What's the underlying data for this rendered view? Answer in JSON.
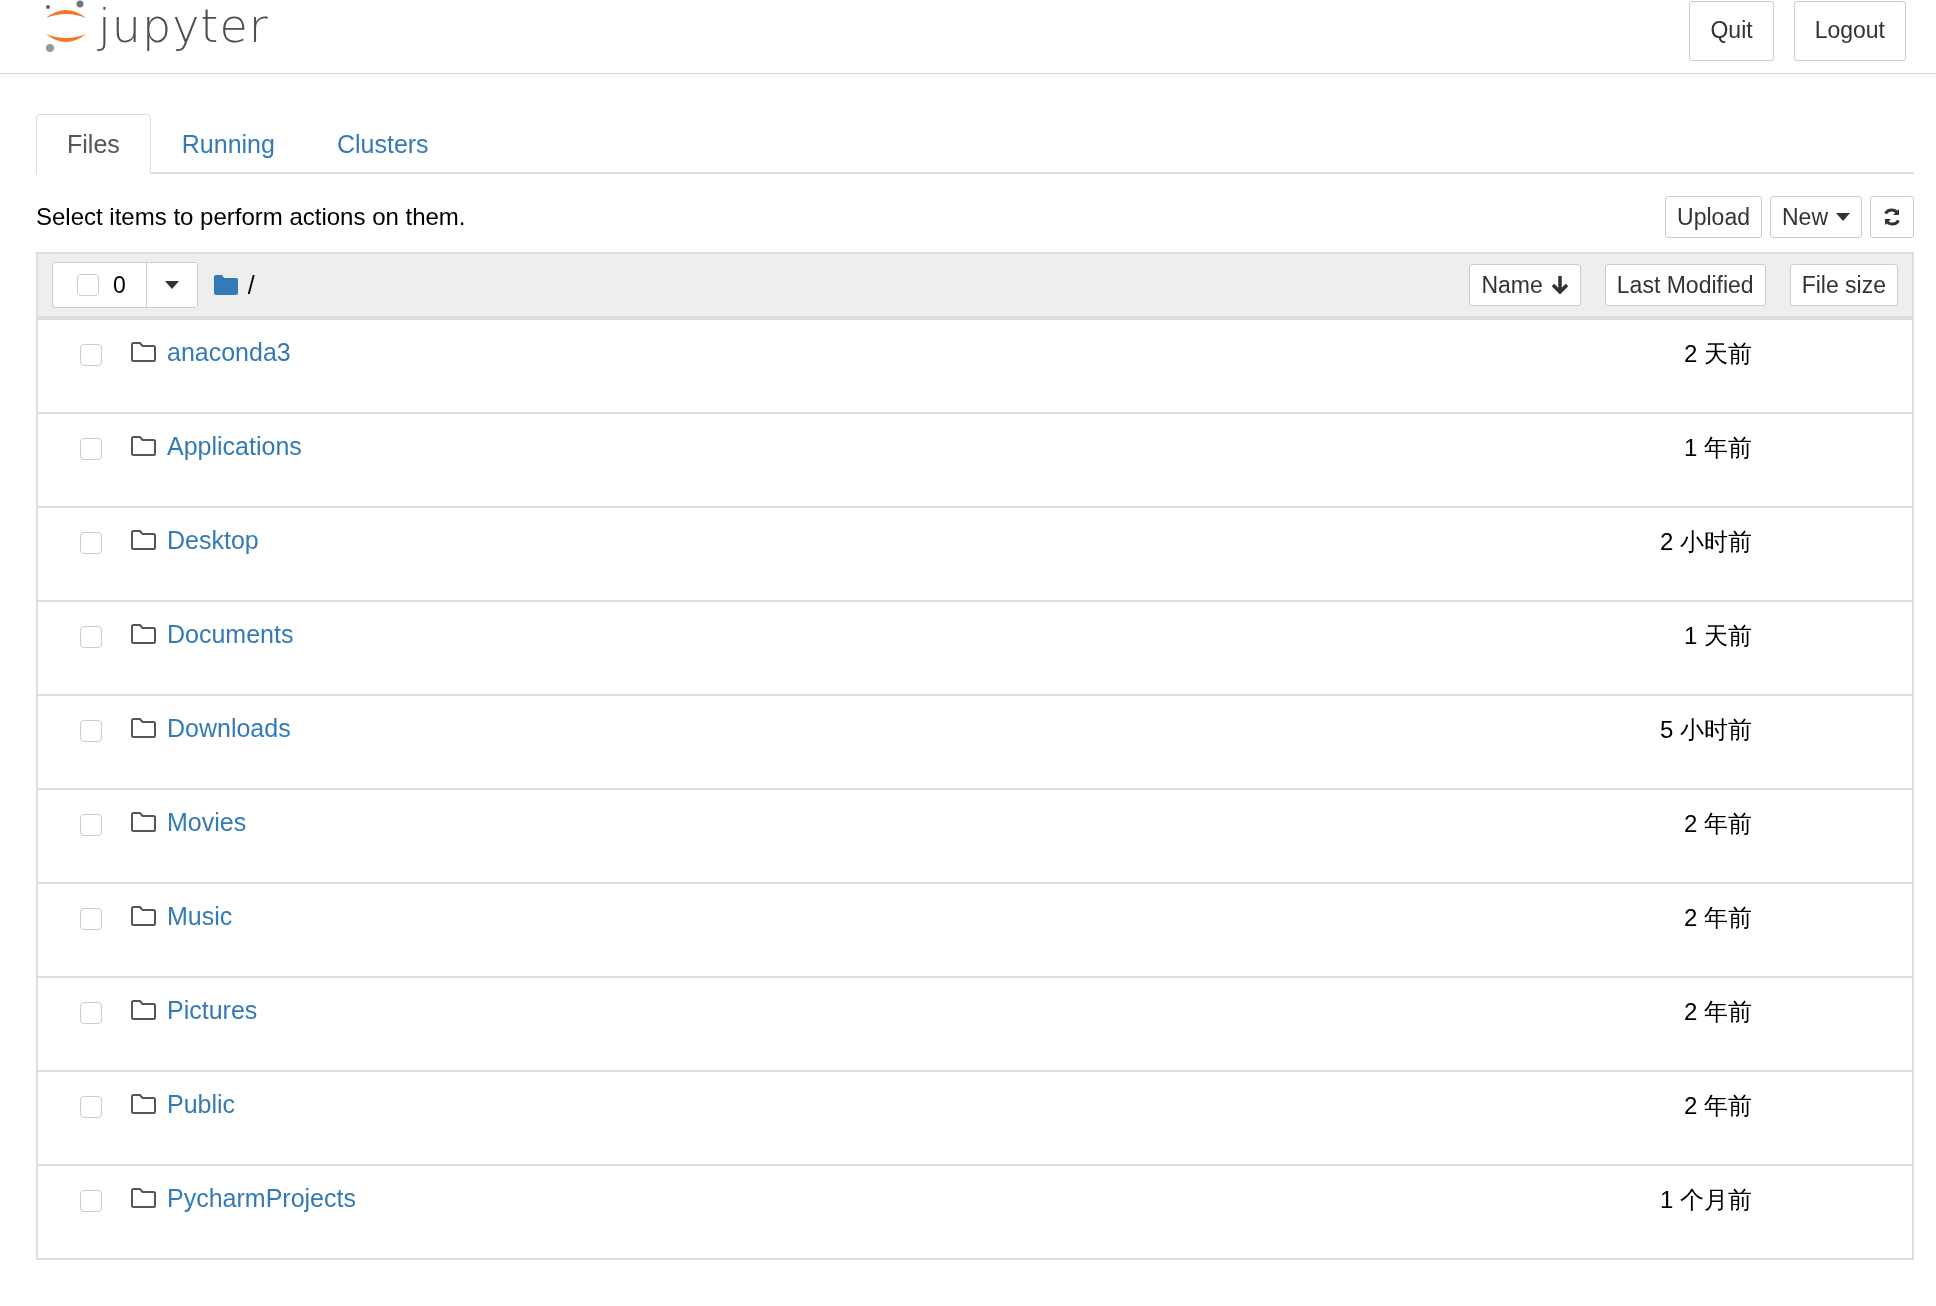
{
  "header": {
    "logo_text": "jupyter",
    "buttons": [
      "Quit",
      "Logout"
    ]
  },
  "tabs": [
    {
      "label": "Files",
      "selected": true
    },
    {
      "label": "Running",
      "selected": false
    },
    {
      "label": "Clusters",
      "selected": false
    }
  ],
  "instructions": "Select items to perform actions on them.",
  "actions": {
    "upload": "Upload",
    "new": "New"
  },
  "list_header": {
    "select_all_checked": false,
    "selected_count": "0",
    "path": "/",
    "sort_buttons": [
      "Name",
      "Last Modified",
      "File size"
    ]
  },
  "rows": [
    {
      "name": "anaconda3",
      "modified": "2 天前",
      "checked": false
    },
    {
      "name": "Applications",
      "modified": "1 年前",
      "checked": false
    },
    {
      "name": "Desktop",
      "modified": "2 小时前",
      "checked": false
    },
    {
      "name": "Documents",
      "modified": "1 天前",
      "checked": false
    },
    {
      "name": "Downloads",
      "modified": "5 小时前",
      "checked": false
    },
    {
      "name": "Movies",
      "modified": "2 年前",
      "checked": false
    },
    {
      "name": "Music",
      "modified": "2 年前",
      "checked": false
    },
    {
      "name": "Pictures",
      "modified": "2 年前",
      "checked": false
    },
    {
      "name": "Public",
      "modified": "2 年前",
      "checked": false
    },
    {
      "name": "PycharmProjects",
      "modified": "1 个月前",
      "checked": false
    }
  ]
}
